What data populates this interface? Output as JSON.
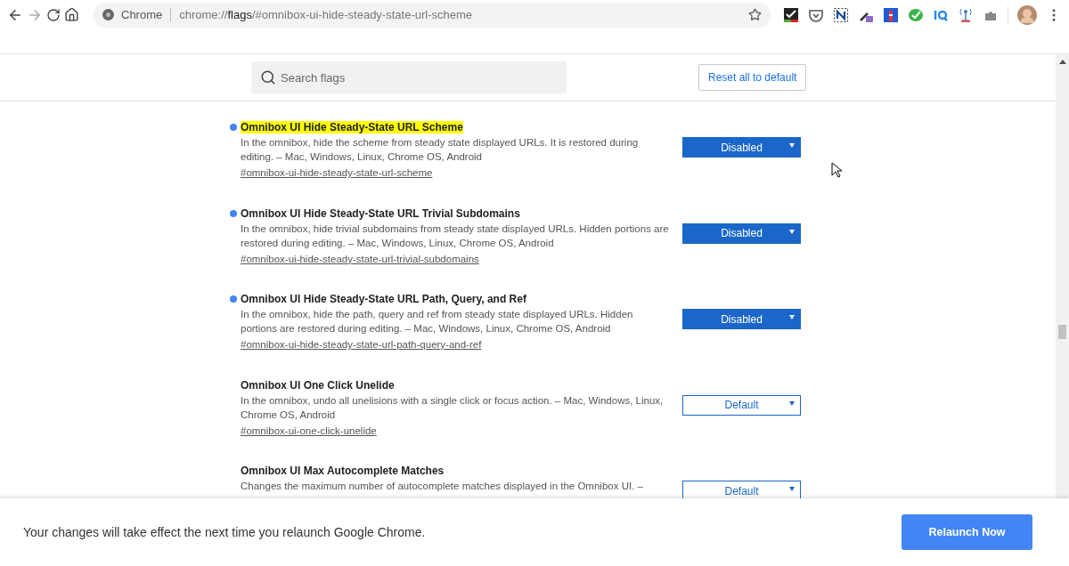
{
  "toolbar": {
    "omnibox": {
      "site_label": "Chrome",
      "url_host": "chrome://",
      "url_page": "flags",
      "url_rest": "/#omnibox-ui-hide-steady-state-url-scheme"
    }
  },
  "header": {
    "search": {
      "placeholder": "Search flags"
    },
    "reset_button": "Reset all to default"
  },
  "flags": [
    {
      "title": "Omnibox UI Hide Steady-State URL Scheme",
      "highlighted": true,
      "modified": true,
      "description": "In the omnibox, hide the scheme from steady state displayed URLs. It is restored during editing. – Mac, Windows, Linux, Chrome OS, Android",
      "link": "#omnibox-ui-hide-steady-state-url-scheme",
      "value": "Disabled"
    },
    {
      "title": "Omnibox UI Hide Steady-State URL Trivial Subdomains",
      "highlighted": false,
      "modified": true,
      "description": "In the omnibox, hide trivial subdomains from steady state displayed URLs. Hidden portions are restored during editing. – Mac, Windows, Linux, Chrome OS, Android",
      "link": "#omnibox-ui-hide-steady-state-url-trivial-subdomains",
      "value": "Disabled"
    },
    {
      "title": "Omnibox UI Hide Steady-State URL Path, Query, and Ref",
      "highlighted": false,
      "modified": true,
      "description": "In the omnibox, hide the path, query and ref from steady state displayed URLs. Hidden portions are restored during editing. – Mac, Windows, Linux, Chrome OS, Android",
      "link": "#omnibox-ui-hide-steady-state-url-path-query-and-ref",
      "value": "Disabled"
    },
    {
      "title": "Omnibox UI One Click Unelide",
      "highlighted": false,
      "modified": false,
      "description": "In the omnibox, undo all unelisions with a single click or focus action. – Mac, Windows, Linux, Chrome OS, Android",
      "link": "#omnibox-ui-one-click-unelide",
      "value": "Default"
    },
    {
      "title": "Omnibox UI Max Autocomplete Matches",
      "highlighted": false,
      "modified": false,
      "description": "Changes the maximum number of autocomplete matches displayed in the Omnibox UI. –",
      "value": "Default"
    }
  ],
  "footer": {
    "message": "Your changes will take effect the next time you relaunch Google Chrome.",
    "button": "Relaunch Now"
  }
}
